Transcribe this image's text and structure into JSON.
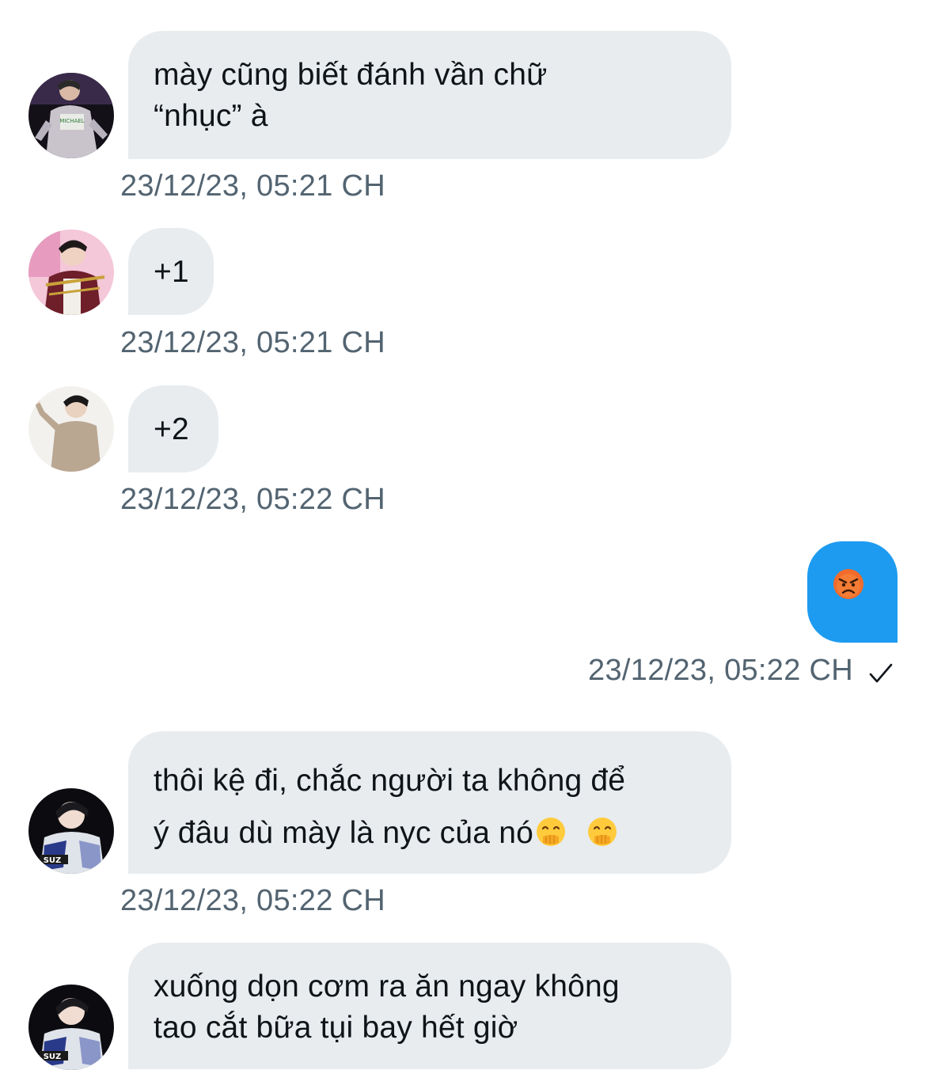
{
  "messages": [
    {
      "sender": "avatar-1",
      "lines": [
        "mày cũng biết đánh vần chữ",
        "“nhục” à"
      ],
      "time": "23/12/23, 05:21 CH"
    },
    {
      "sender": "avatar-2",
      "lines": [
        "+1"
      ],
      "time": "23/12/23, 05:21 CH"
    },
    {
      "sender": "avatar-3",
      "lines": [
        "+2"
      ],
      "time": "23/12/23, 05:22 CH"
    },
    {
      "sender": "avatar-4",
      "lines": [
        "thôi kệ đi, chắc người ta không để",
        "ý đâu dù mày là nyc của nó"
      ],
      "emojis": [
        "face-with-hand-over-mouth",
        "face-with-hand-over-mouth"
      ],
      "time": "23/12/23, 05:22 CH"
    },
    {
      "sender": "avatar-4",
      "lines": [
        "xuống dọn cơm ra ăn ngay không",
        "tao cắt bữa tụi bay hết giờ"
      ]
    }
  ],
  "outgoing": {
    "emoji": "angry-face",
    "time": "23/12/23, 05:22 CH",
    "status_icon": "checkmark-icon"
  },
  "colors": {
    "incoming_bubble": "#e8ecef",
    "outgoing_bubble": "#1d9bf0",
    "timestamp": "#536471",
    "text": "#0f1419"
  }
}
